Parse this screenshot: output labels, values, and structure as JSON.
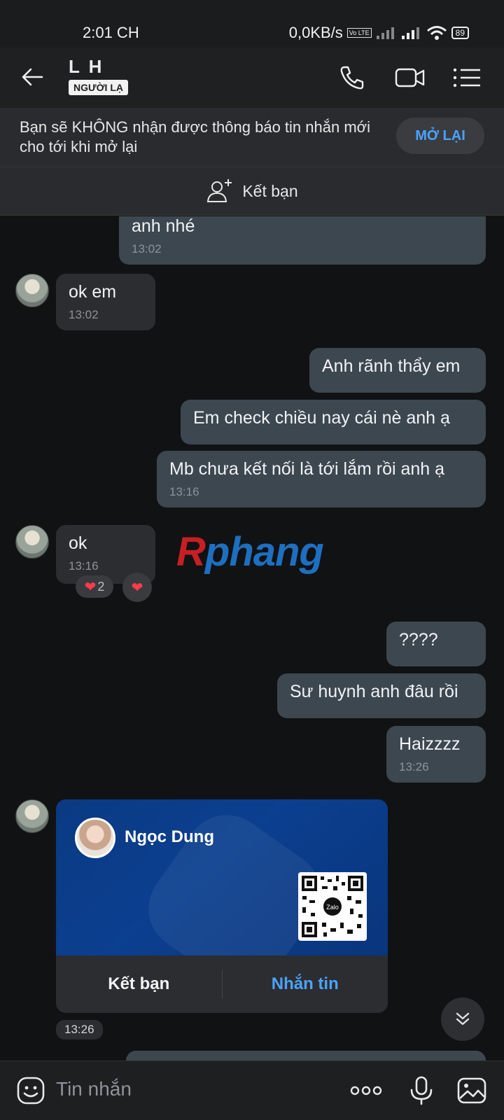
{
  "status_bar": {
    "time": "2:01 CH",
    "network_speed": "0,0KB/s",
    "volte": "Vo LTE",
    "battery": "89"
  },
  "header": {
    "contact_name": "L H",
    "stranger_badge": "NGƯỜI LẠ",
    "icons": [
      "back-arrow-icon",
      "phone-icon",
      "video-call-icon",
      "menu-list-icon"
    ]
  },
  "notice": {
    "text": "Bạn sẽ KHÔNG nhận được thông báo tin nhắn mới cho tới khi mở lại",
    "button": "MỞ LẠI"
  },
  "add_friend": {
    "label": "Kết bạn"
  },
  "messages": [
    {
      "from": "me",
      "text": "anh nhé",
      "time": "13:02"
    },
    {
      "from": "them",
      "text": "ok em",
      "time": "13:02"
    },
    {
      "from": "me",
      "text": "Anh rãnh thẩy em"
    },
    {
      "from": "me",
      "text": "Em check chiều nay cái nè anh ạ"
    },
    {
      "from": "me",
      "text": "Mb chưa kết nối là tới lắm rồi anh ạ",
      "time": "13:16"
    },
    {
      "from": "them",
      "text": "ok",
      "time": "13:16",
      "reaction_count": "2"
    },
    {
      "from": "me",
      "text": "????"
    },
    {
      "from": "me",
      "text": "Sư huynh anh đâu rồi"
    },
    {
      "from": "me",
      "text": "Haizzzz",
      "time": "13:26"
    }
  ],
  "watermark": {
    "first": "R",
    "rest": "phang"
  },
  "contact_card": {
    "name": "Ngọc Dung",
    "qr_label": "Zalo",
    "add_friend": "Kết bạn",
    "message": "Nhắn tin",
    "time": "13:26"
  },
  "input": {
    "placeholder": "Tin nhắn",
    "icons": [
      "emoji-icon",
      "more-icon",
      "microphone-icon",
      "image-icon"
    ]
  },
  "colors": {
    "accent": "#4aa3ff",
    "bubble_out": "#3d4750",
    "bubble_in": "#2c2d30",
    "card_blue": "#0b3f8f"
  }
}
